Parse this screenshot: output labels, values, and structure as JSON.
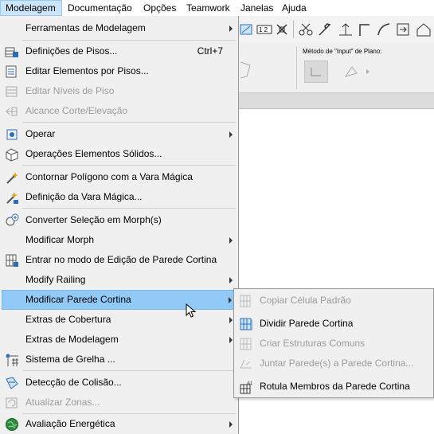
{
  "menubar": {
    "items": [
      {
        "label": "Modelagem",
        "active": true
      },
      {
        "label": "Documentação"
      },
      {
        "label": "Opções"
      },
      {
        "label": "Teamwork"
      },
      {
        "label": "Janelas"
      },
      {
        "label": "Ajuda"
      }
    ]
  },
  "infobox": {
    "label": "Método de \"Input\" de Plano:"
  },
  "menu": {
    "items": [
      {
        "label": "Ferramentas de Modelagem",
        "icon": "none",
        "submenu": true
      },
      {
        "label": "Definições de Pisos...",
        "shortcut": "Ctrl+7",
        "icon": "floor-settings-icon"
      },
      {
        "label": "Editar Elementos por Pisos...",
        "icon": "edit-by-floors-icon"
      },
      {
        "label": "Editar Níveis de Piso",
        "icon": "floor-levels-icon",
        "disabled": true
      },
      {
        "label": "Alcance Corte/Elevação",
        "icon": "section-range-icon",
        "disabled": true
      },
      {
        "label": "Operar",
        "icon": "operate-icon",
        "submenu": true
      },
      {
        "label": "Operações Elementos Sólidos...",
        "icon": "solid-operations-icon"
      },
      {
        "label": "Contornar Polígono com a Vara Mágica",
        "icon": "magic-wand-icon"
      },
      {
        "label": "Definição da Vara Mágica...",
        "icon": "magic-wand-settings-icon"
      },
      {
        "label": "Converter Seleção em Morph(s)",
        "icon": "convert-morph-icon"
      },
      {
        "label": "Modificar Morph",
        "icon": "none",
        "submenu": true
      },
      {
        "label": "Entrar no modo de Edição de Parede Cortina",
        "icon": "curtain-wall-edit-icon"
      },
      {
        "label": "Modify Railing",
        "icon": "none",
        "submenu": true
      },
      {
        "label": "Modificar Parede Cortina",
        "icon": "none",
        "submenu": true,
        "highlighted": true
      },
      {
        "label": "Extras de Cobertura",
        "icon": "none",
        "submenu": true
      },
      {
        "label": "Extras de Modelagem",
        "icon": "none",
        "submenu": true
      },
      {
        "label": "Sistema de Grelha ...",
        "icon": "grid-system-icon"
      },
      {
        "label": "Detecção de Colisão...",
        "icon": "collision-detection-icon"
      },
      {
        "label": "Atualizar Zonas...",
        "icon": "update-zones-icon",
        "disabled": true
      },
      {
        "label": "Avaliação Energética",
        "icon": "energy-evaluation-icon",
        "submenu": true
      }
    ]
  },
  "submenu": {
    "items": [
      {
        "label": "Copiar Célula Padrão",
        "icon": "copy-cell-icon",
        "disabled": true
      },
      {
        "label": "Dividir Parede Cortina",
        "icon": "divide-curtain-wall-icon"
      },
      {
        "label": "Criar Estruturas Comuns",
        "icon": "common-structures-icon",
        "disabled": true
      },
      {
        "label": "Juntar Parede(s) a Parede Cortina...",
        "icon": "join-walls-icon",
        "disabled": true
      },
      {
        "label": "Rotula Membros da Parede Cortina",
        "icon": "label-members-icon"
      }
    ]
  },
  "colors": {
    "highlight": "#91c9f7",
    "menubar_active": "#cce4f7",
    "disabled_text": "#9b9b9b",
    "icon_blue": "#2a6ebb"
  }
}
